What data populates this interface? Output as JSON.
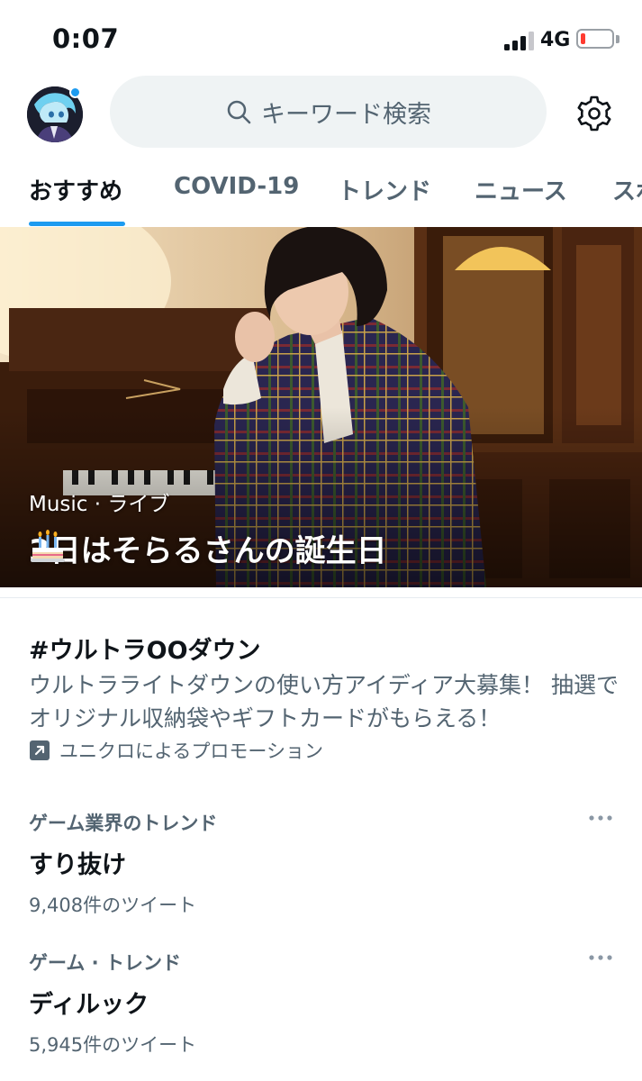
{
  "status_bar": {
    "time": "0:07",
    "network": "4G",
    "battery_level": 0.15,
    "signal_bars_active": 3,
    "signal_bars_total": 4
  },
  "header": {
    "search_placeholder": "キーワード検索",
    "accent_color": "#1d9bf0"
  },
  "tabs": [
    {
      "label": "おすすめ",
      "active": true
    },
    {
      "label": "COVID-19",
      "active": false
    },
    {
      "label": "トレンド",
      "active": false
    },
    {
      "label": "ニュース",
      "active": false
    },
    {
      "label": "スポ",
      "active": false
    }
  ],
  "hero": {
    "category": "Music · ライブ",
    "title": "3日はそらるさんの誕生日",
    "emoji_icon": "birthday-cake-icon"
  },
  "promoted": {
    "title": "#ウルトラOOダウン",
    "description": "ウルトラライトダウンの使い方アイディア大募集！ 抽選でオリジナル収納袋やギフトカードがもらえる！",
    "promoted_by": "ユニクロによるプロモーション"
  },
  "trends": [
    {
      "context": "ゲーム業界のトレンド",
      "name": "すり抜け",
      "count": "9,408件のツイート"
    },
    {
      "context": "ゲーム · トレンド",
      "name": "ディルック",
      "count": "5,945件のツイート"
    }
  ]
}
